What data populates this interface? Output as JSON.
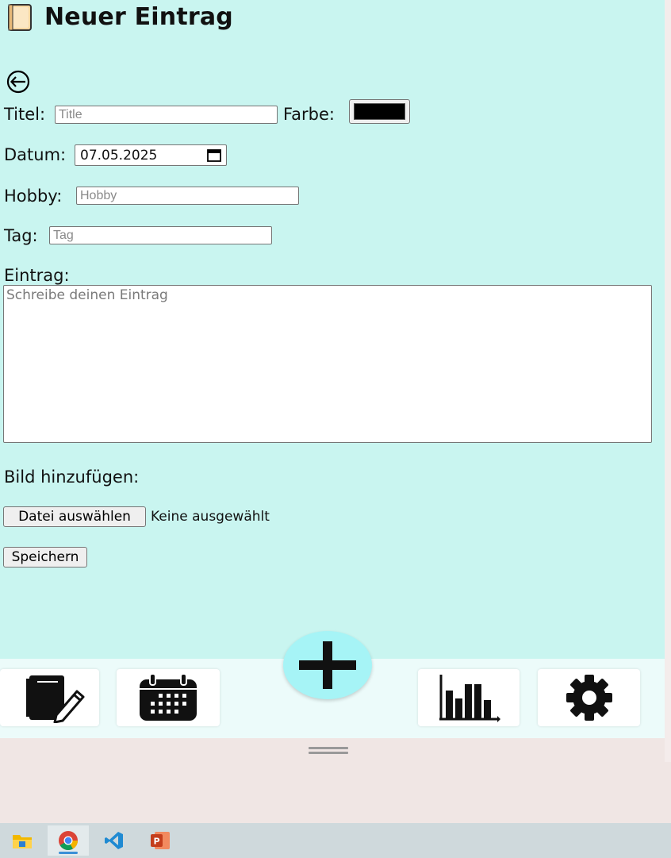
{
  "header": {
    "title": "Neuer Eintrag",
    "icon": "notebook-icon"
  },
  "form": {
    "back_icon": "back-arrow-icon",
    "title_label": "Titel:",
    "title_placeholder": "Title",
    "color_label": "Farbe:",
    "color_value": "#000000",
    "date_label": "Datum:",
    "date_value": "07.05.2025",
    "hobby_label": "Hobby:",
    "hobby_placeholder": "Hobby",
    "tag_label": "Tag:",
    "tag_placeholder": "Tag",
    "entry_label": "Eintrag:",
    "entry_placeholder": "Schreibe deinen Eintrag",
    "image_label": "Bild hinzufügen:",
    "file_button": "Datei auswählen",
    "file_status": "Keine ausgewählt",
    "save_button": "Speichern"
  },
  "nav": {
    "items": [
      {
        "name": "entries",
        "icon": "notebook-pen-icon"
      },
      {
        "name": "calendar",
        "icon": "calendar-icon"
      },
      {
        "name": "add",
        "icon": "plus-icon"
      },
      {
        "name": "statistics",
        "icon": "bar-chart-icon"
      },
      {
        "name": "settings",
        "icon": "gear-icon"
      }
    ]
  },
  "taskbar": {
    "apps": [
      {
        "name": "file-explorer",
        "icon": "folder-icon"
      },
      {
        "name": "chrome",
        "icon": "chrome-icon",
        "active": true
      },
      {
        "name": "vscode",
        "icon": "vscode-icon"
      },
      {
        "name": "powerpoint",
        "icon": "powerpoint-icon"
      }
    ]
  },
  "colors": {
    "app_background": "#c9f5f0",
    "fab": "#a6f4f6",
    "nav_background": "#ecfbfa"
  }
}
